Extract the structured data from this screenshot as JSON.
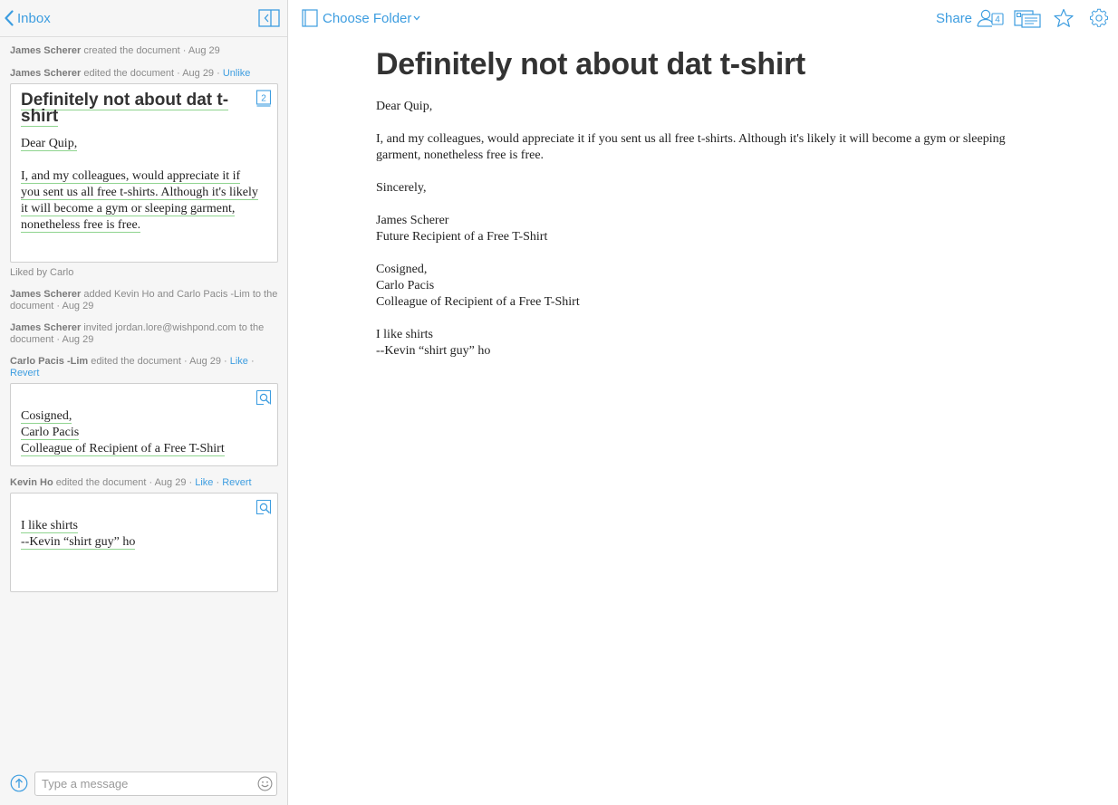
{
  "sidebar": {
    "back_label": "Inbox",
    "events": [
      {
        "who": "James Scherer",
        "text": " created the document · Aug 29"
      },
      {
        "who": "James Scherer",
        "text": " edited the document · Aug 29 · ",
        "link": "Unlike"
      },
      {
        "text": "Liked by Carlo"
      },
      {
        "who": "James Scherer",
        "text": " added Kevin Ho and Carlo Pacis -Lim to the document · Aug 29"
      },
      {
        "who": "James Scherer",
        "text": " invited jordan.lore@wishpond.com to the document · Aug 29"
      },
      {
        "who": "Carlo Pacis -Lim",
        "text": " edited the document · Aug 29 · ",
        "link": "Like",
        "sep": " · ",
        "link2": "Revert"
      },
      {
        "who": "Kevin Ho",
        "text": " edited the document · Aug 29 · ",
        "link": "Like",
        "sep": " · ",
        "link2": "Revert"
      }
    ],
    "card1": {
      "badge": "2",
      "title_l1": "Definitely not about dat t-",
      "title_l2": "shirt",
      "lines": [
        "Dear Quip,",
        "",
        "I, and my colleagues, would appreciate it if",
        "you sent us all free t-shirts. Although it's likely",
        "it will become a gym or sleeping garment,",
        "nonetheless free is free."
      ]
    },
    "card2": {
      "lines": [
        "Cosigned,",
        "Carlo Pacis",
        "Colleague of Recipient of a Free T-Shirt"
      ]
    },
    "card3": {
      "lines": [
        "I like shirts",
        "--Kevin “shirt guy” ho"
      ]
    },
    "composer": {
      "placeholder": "Type a message"
    }
  },
  "topbar": {
    "folder_label": "Choose Folder",
    "share_label": "Share",
    "member_count": "4"
  },
  "document": {
    "title": "Definitely not about dat t-shirt",
    "paragraphs": [
      [
        "Dear Quip,"
      ],
      [
        "I, and my colleagues, would appreciate it if you sent us all free t-shirts. Although it's likely it will become a gym or sleeping",
        "garment, nonetheless free is free."
      ],
      [
        "Sincerely,"
      ],
      [
        "James Scherer",
        "Future Recipient of a Free T-Shirt"
      ],
      [
        "Cosigned,",
        "Carlo Pacis",
        "Colleague of Recipient of a Free T-Shirt"
      ],
      [
        "I like shirts",
        "--Kevin “shirt guy” ho"
      ]
    ]
  },
  "colors": {
    "accent": "#3d9de0",
    "sidebar_bg": "#f6f6f6",
    "edit_underline": "#8fd48f"
  },
  "icons": [
    "chevron-left-icon",
    "collapse-sidebar-icon",
    "folder-icon",
    "chevron-down-icon",
    "people-icon",
    "doc-outline-icon",
    "star-icon",
    "gear-icon",
    "send-icon",
    "emoji-icon",
    "view-diff-icon"
  ]
}
